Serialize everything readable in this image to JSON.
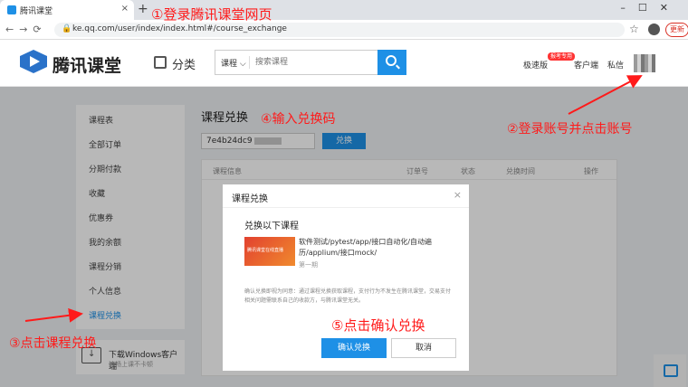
{
  "browser": {
    "tab_title": "腾讯课堂",
    "tab_close": "×",
    "new_tab": "+",
    "url": "ke.qq.com/user/index/index.html#/course_exchange",
    "update_label": "更新"
  },
  "header": {
    "logo_text": "腾讯课堂",
    "category_label": "分类",
    "search_type": "课程 ⌵",
    "search_placeholder": "搜索课程",
    "links": {
      "express": "极速版",
      "express_badge": "报考专用",
      "client": "客户端",
      "messages": "私信"
    }
  },
  "sidebar": {
    "items": [
      {
        "label": "课程表"
      },
      {
        "label": "全部订单"
      },
      {
        "label": "分期付款"
      },
      {
        "label": "收藏"
      },
      {
        "label": "优惠券"
      },
      {
        "label": "我的余额"
      },
      {
        "label": "课程分销"
      },
      {
        "label": "个人信息"
      },
      {
        "label": "课程兑换"
      }
    ],
    "download": {
      "title": "下载Windows客户端",
      "subtitle": "流畅上课不卡顿"
    }
  },
  "main": {
    "title": "课程兑换",
    "code_value": "7e4b24dc9",
    "redeem_label": "兑换",
    "columns": [
      "课程信息",
      "订单号",
      "状态",
      "兑换时间",
      "操作"
    ]
  },
  "modal": {
    "title": "课程兑换",
    "close": "×",
    "subtitle": "兑换以下课程",
    "course_name": "软件测试/pytest/app/接口自动化/自动遍历/applium/接口mock/",
    "course_term": "第一期",
    "thumb_text": "腾讯课堂在线直播",
    "note": "确认兑换即视为同意：通过课程兑换获取课程，支付行为不发生在腾讯课堂，交易支付相关问题需联系自己的收款方，与腾讯课堂无关。",
    "confirm_label": "确认兑换",
    "cancel_label": "取消"
  },
  "annotations": {
    "step1": "①登录腾讯课堂网页",
    "step2": "②登录账号并点击账号",
    "step3": "③点击课程兑换",
    "step4": "④输入兑换码",
    "step5": "⑤点击确认兑换"
  },
  "colors": {
    "accent": "#1e90e6",
    "annotation": "#ff1a1a"
  }
}
